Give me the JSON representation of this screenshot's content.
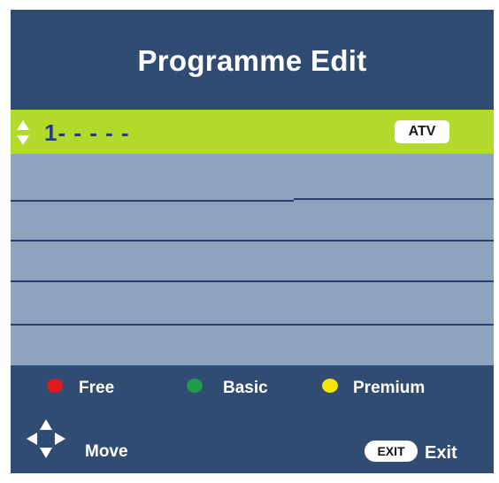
{
  "title": "Programme Edit",
  "selected_row": {
    "name": "1- - - - -",
    "type_badge": "ATV"
  },
  "legend": [
    {
      "label": "Free",
      "color": "#e0191f"
    },
    {
      "label": "Basic",
      "color": "#1f9c47"
    },
    {
      "label": "Premium",
      "color": "#f4e40c"
    }
  ],
  "controls": {
    "move_label": "Move",
    "exit_key": "EXIT",
    "exit_label": "Exit"
  },
  "colors": {
    "header_bg": "#304c73",
    "list_bg": "#8ea3bd",
    "highlight": "#b2da2b",
    "channel_text": "#27378f"
  }
}
